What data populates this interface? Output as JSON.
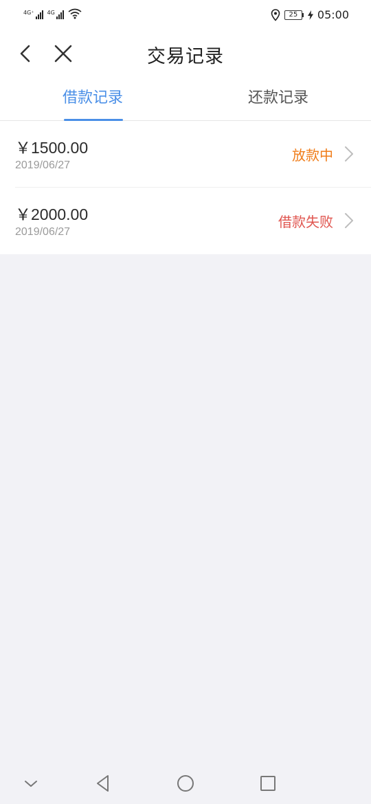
{
  "status_bar": {
    "signal1_label": "4G⁺",
    "signal2_label": "4G",
    "battery": "25",
    "time": "05:00"
  },
  "header": {
    "title": "交易记录",
    "tabs": [
      {
        "label": "借款记录",
        "active": true
      },
      {
        "label": "还款记录",
        "active": false
      }
    ]
  },
  "records": [
    {
      "amount": "￥1500.00",
      "date": "2019/06/27",
      "status": "放款中",
      "status_color": "#f07d1a"
    },
    {
      "amount": "￥2000.00",
      "date": "2019/06/27",
      "status": "借款失败",
      "status_color": "#e0554f"
    }
  ],
  "colors": {
    "accent": "#4a8fe7",
    "background": "#f2f2f6"
  },
  "icons": {
    "back": "chevron-left-icon",
    "close": "close-icon",
    "row_arrow": "chevron-right-icon",
    "nav": [
      "chevron-down-icon",
      "back-triangle-icon",
      "home-circle-icon",
      "recents-square-icon"
    ]
  }
}
